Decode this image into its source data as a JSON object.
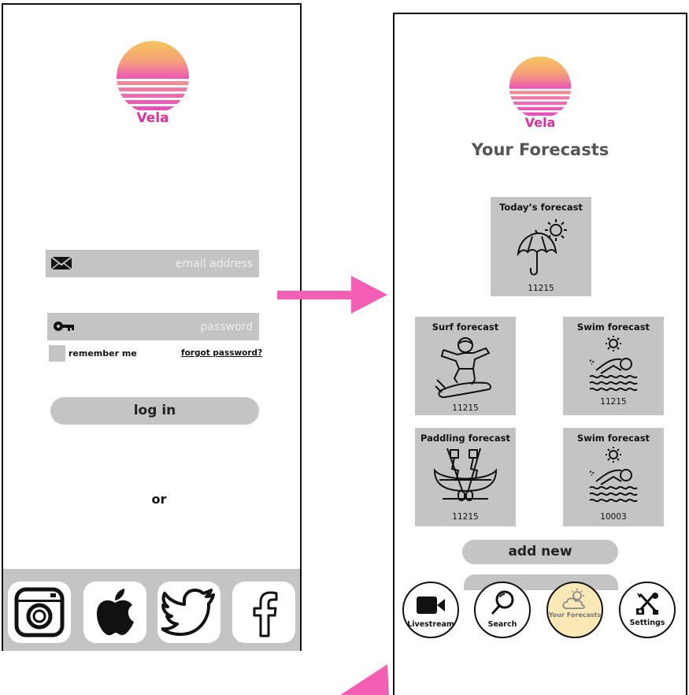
{
  "brand": {
    "name": "Vela"
  },
  "login": {
    "email_placeholder": "email address",
    "password_placeholder": "password",
    "remember_label": "remember me",
    "forgot_label": "forgot password?",
    "login_label": "log in",
    "or_label": "or",
    "social": [
      {
        "name": "instagram-icon"
      },
      {
        "name": "apple-icon"
      },
      {
        "name": "twitter-icon"
      },
      {
        "name": "facebook-icon"
      }
    ]
  },
  "forecasts": {
    "title": "Your Forecasts",
    "cards": [
      {
        "title": "Today’s forecast",
        "zip": "11215",
        "icon": "umbrella-sun-icon"
      },
      {
        "title": "Surf forecast",
        "zip": "11215",
        "icon": "surfer-icon"
      },
      {
        "title": "Swim forecast",
        "zip": "11215",
        "icon": "swimmer-icon"
      },
      {
        "title": "Paddling forecast",
        "zip": "11215",
        "icon": "canoe-icon"
      },
      {
        "title": "Swim forecast",
        "zip": "10003",
        "icon": "swimmer-icon"
      }
    ],
    "add_new_label": "add new",
    "nav": [
      {
        "label": "Livestream",
        "icon": "video-camera-icon"
      },
      {
        "label": "Search",
        "icon": "magnifier-icon"
      },
      {
        "label": "Your Forecasts",
        "icon": "cloud-sun-icon",
        "active": true
      },
      {
        "label": "Settings",
        "icon": "tools-icon"
      }
    ]
  },
  "colors": {
    "accent_pink": "#e0309c",
    "arrow_pink": "#f45fb6",
    "gray": "#c4c4c4",
    "active_nav": "#fae9b6",
    "sun_top": "#f7c85a",
    "sun_bottom": "#f062b8"
  }
}
